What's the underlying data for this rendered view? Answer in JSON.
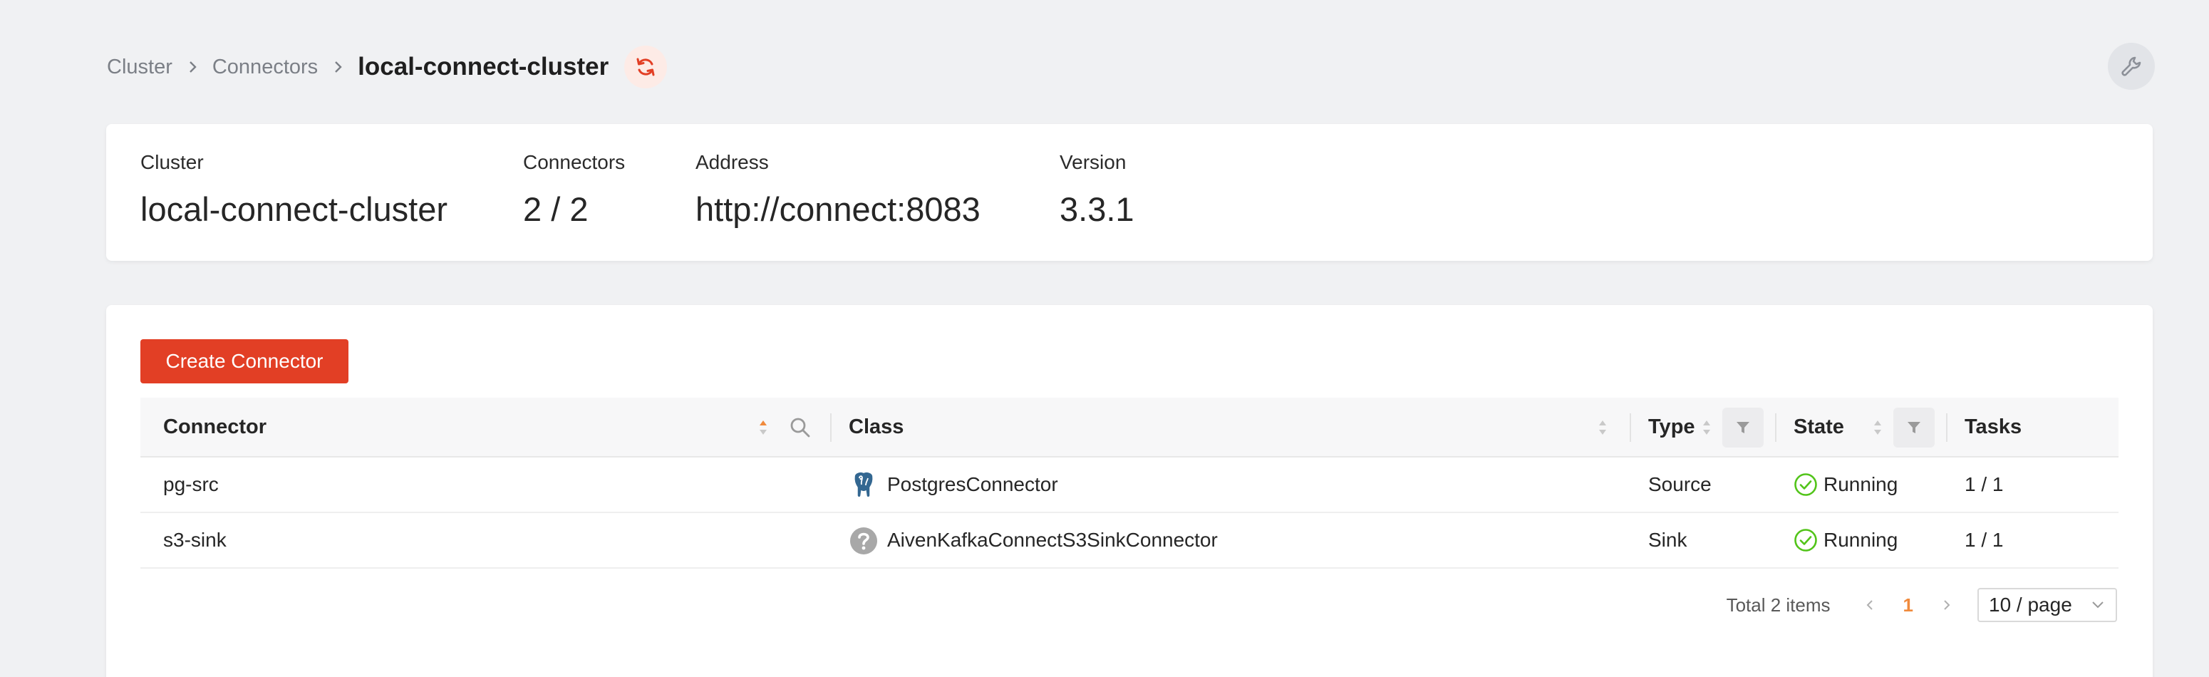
{
  "breadcrumb": {
    "items": [
      "Cluster",
      "Connectors"
    ],
    "current": "local-connect-cluster"
  },
  "cluster_info": {
    "cluster": {
      "label": "Cluster",
      "value": "local-connect-cluster"
    },
    "connectors": {
      "label": "Connectors",
      "value": "2 / 2"
    },
    "address": {
      "label": "Address",
      "value": "http://connect:8083"
    },
    "version": {
      "label": "Version",
      "value": "3.3.1"
    }
  },
  "actions": {
    "create_connector": "Create Connector"
  },
  "table": {
    "columns": {
      "connector": "Connector",
      "class": "Class",
      "type": "Type",
      "state": "State",
      "tasks": "Tasks"
    },
    "rows": [
      {
        "connector": "pg-src",
        "class": "PostgresConnector",
        "class_icon": "postgres-elephant-icon",
        "type": "Source",
        "state": "Running",
        "tasks": "1 / 1"
      },
      {
        "connector": "s3-sink",
        "class": "AivenKafkaConnectS3SinkConnector",
        "class_icon": "question-circle-icon",
        "type": "Sink",
        "state": "Running",
        "tasks": "1 / 1"
      }
    ]
  },
  "pagination": {
    "total": "Total 2 items",
    "current_page": "1",
    "page_size": "10 / page"
  },
  "colors": {
    "accent": "#e23f25",
    "page_active": "#f08a3c",
    "running": "#52c41a",
    "background": "#f0f1f3"
  }
}
